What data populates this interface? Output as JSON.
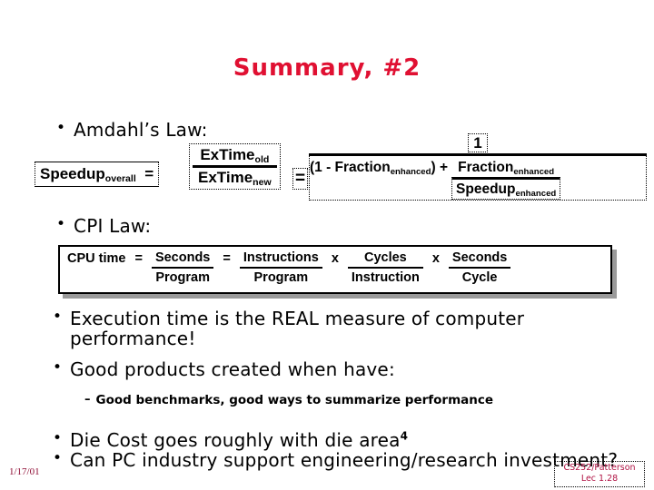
{
  "slide": {
    "title": "Summary, #2",
    "title_color": "#e01032",
    "background": "#ffffff"
  },
  "bullets": {
    "amdahl_heading": "Amdahl’s Law:",
    "cpi_heading": "CPI Law:",
    "exec_time": "Execution time is the REAL measure of computer performance!",
    "good_products": "Good products created when have:",
    "benchmarks_sub": "Good benchmarks, good ways to summarize performance",
    "die_cost_main": "Die Cost goes roughly with die area",
    "die_cost_exponent": "4",
    "pc_industry": "Can PC industry support engineering/research investment?",
    "bullet_mark": "•",
    "dash_mark": "–"
  },
  "amdahl_equation": {
    "lhs_base": "Speedup",
    "lhs_sub": "overall",
    "equals_1": "=",
    "numerator_base": "ExTime",
    "numerator_sub": "old",
    "denominator_base": "ExTime",
    "denominator_sub": "new",
    "equals_2": "=",
    "right_numerator": "1",
    "den_lead": "(1 - Fraction",
    "den_lead_sub": "enhanced",
    "den_lead_tail": ") +  ",
    "inner_num_base": "Fraction",
    "inner_num_sub": "enhanced",
    "inner_den_base": "Speedup",
    "inner_den_sub": "enhanced"
  },
  "cpi_equation": {
    "label": "CPU time",
    "equals_1": "=",
    "f1_num": "Seconds",
    "f1_den": "Program",
    "equals_2": "=",
    "f2_num": "Instructions",
    "f2_den": "Program",
    "times_1": "x",
    "f3_num": "Cycles",
    "f3_den": "Instruction",
    "times_2": "x",
    "f4_num": "Seconds",
    "f4_den": "Cycle"
  },
  "footer": {
    "date": "1/17/01",
    "course": "CS252/Patterson",
    "lecture": "Lec 1.28",
    "color": "#b01243"
  }
}
